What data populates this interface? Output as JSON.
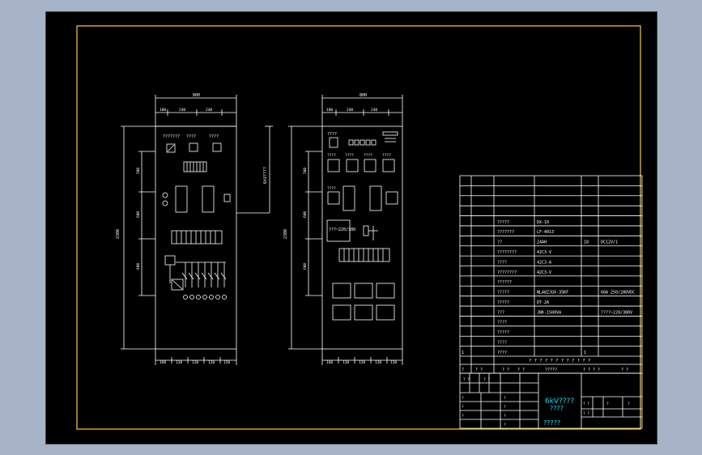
{
  "front_view": {
    "top_width": "800",
    "top_segments": [
      "180",
      "240",
      "240"
    ],
    "height_dim": "2300",
    "vdims": [
      "500",
      "600",
      "600"
    ],
    "bottom_segments": [
      "160",
      "120",
      "120",
      "120",
      "120"
    ],
    "meter_labels": [
      "???????",
      "????",
      "????"
    ],
    "voltage_note": "??????"
  },
  "side_view": {
    "top_width": "800",
    "top_segments": [
      "180",
      "240",
      "240"
    ],
    "height_dim": "2300",
    "vdims": [
      "500",
      "600",
      "600"
    ],
    "bottom_segments": [
      "160",
      "120",
      "120",
      "120",
      "120"
    ],
    "labels": [
      "????",
      "????",
      "????",
      "????",
      "????",
      "????"
    ],
    "box_note": "???~220/380",
    "width_dim": "6kV????"
  },
  "bom": {
    "rows": [
      {
        "name": "?????",
        "model": "DX-10",
        "qty": "",
        "note": ""
      },
      {
        "name": "???????",
        "model": "LF-4013",
        "qty": "",
        "note": ""
      },
      {
        "name": "??",
        "model": "24AH",
        "qty": "18",
        "note": "DC12V/1"
      },
      {
        "name": "????????",
        "model": "42C3-V",
        "qty": "",
        "note": ""
      },
      {
        "name": "????",
        "model": "42C3-A",
        "qty": "",
        "note": ""
      },
      {
        "name": "????????",
        "model": "42C3-V",
        "qty": "",
        "note": ""
      },
      {
        "name": "??????",
        "model": "",
        "qty": "",
        "note": ""
      },
      {
        "name": "?????",
        "model": "NLA8ZJQX-35KF",
        "qty": "",
        "note": "60A 250/280VDC"
      },
      {
        "name": "?????",
        "model": "DT-2A",
        "qty": "",
        "note": ""
      },
      {
        "name": "???",
        "model": "JBK-1500VA",
        "qty": "",
        "note": "????~220/380V"
      },
      {
        "name": "????",
        "model": "",
        "qty": "",
        "note": ""
      },
      {
        "name": "?????",
        "model": "",
        "qty": "",
        "note": ""
      },
      {
        "name": "????",
        "model": "",
        "qty": "",
        "note": ""
      },
      {
        "name": "????",
        "model": "",
        "qty": "1",
        "note": ""
      }
    ],
    "footer_title": "? ? ? ? ? ? ? ? ? ? ? ?",
    "header_cells": [
      "?",
      "? ?",
      "? ?",
      "? ?",
      "?????",
      "? ? ? ?",
      "? ?"
    ]
  },
  "title_block": {
    "drawing_title": "6kV????",
    "drawing_subtitle": "????",
    "company": "?????",
    "small_cells": [
      "? ?",
      "? ?",
      "?",
      "?",
      "?",
      "?",
      "?",
      "?",
      "?",
      "? ?",
      "? ?",
      "?",
      "?"
    ]
  },
  "colors": {
    "background": "#000000",
    "frame": "#ffcc33",
    "lines": "#ffffff",
    "title_text": "#00e5ff",
    "app_bg": "#a7b3c6"
  }
}
